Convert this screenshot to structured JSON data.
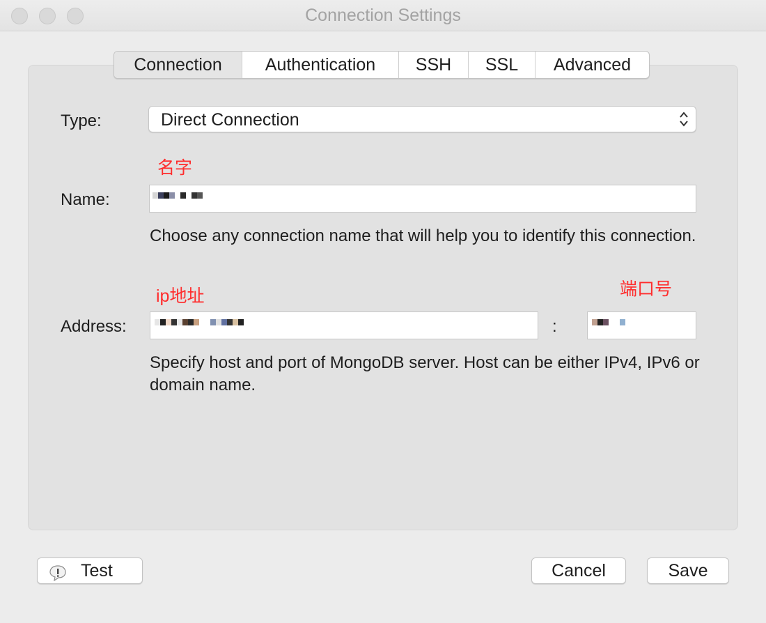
{
  "window": {
    "title": "Connection Settings"
  },
  "tabs": [
    {
      "label": "Connection",
      "active": true
    },
    {
      "label": "Authentication",
      "active": false
    },
    {
      "label": "SSH",
      "active": false
    },
    {
      "label": "SSL",
      "active": false
    },
    {
      "label": "Advanced",
      "active": false
    }
  ],
  "form": {
    "type_label": "Type:",
    "type_value": "Direct Connection",
    "name_label": "Name:",
    "name_help": "Choose any connection name that will help you to identify this connection.",
    "address_label": "Address:",
    "port_separator": ":",
    "address_help": "Specify host and port of MongoDB server. Host can be either IPv4, IPv6 or domain name."
  },
  "annotations": {
    "name": "名字",
    "ip": "ip地址",
    "port": "端口号",
    "color": "#ff2d2d"
  },
  "buttons": {
    "test": "Test",
    "cancel": "Cancel",
    "save": "Save"
  }
}
